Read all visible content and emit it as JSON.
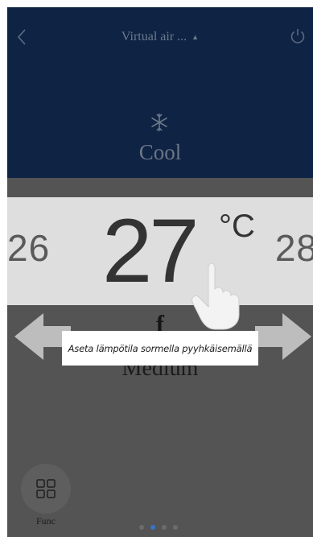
{
  "header": {
    "title": "Virtual air ...",
    "caret_icon": "triangle-down-icon",
    "back_icon": "chevron-left-icon",
    "power_icon": "power-icon"
  },
  "mode": {
    "icon": "snowflake-icon",
    "label": "Cool"
  },
  "temperature": {
    "previous": "26",
    "current": "27",
    "unit": "°C",
    "next": "28"
  },
  "fan": {
    "hint_glyph": "f",
    "label": "Medium"
  },
  "tooltip": {
    "text": "Aseta lämpötila sormella pyyhkäisemällä"
  },
  "func": {
    "label": "Func",
    "icon": "grid-icon"
  },
  "pager": {
    "count": 4,
    "active_index": 1
  },
  "colors": {
    "header_background": "#0f2344",
    "temperature_band": "#dedede",
    "lower_background": "#545454",
    "active_dot": "#3a72c8"
  }
}
